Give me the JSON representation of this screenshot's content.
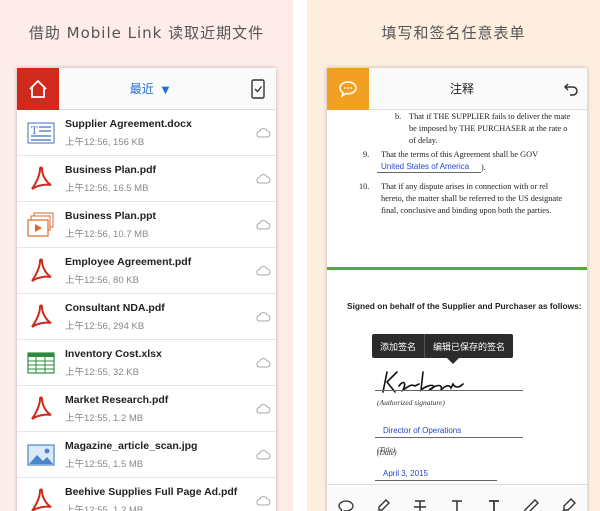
{
  "left": {
    "caption": "借助 Mobile Link 读取近期文件",
    "header": {
      "recent_label": "最近",
      "chevron": "⌄"
    },
    "files": [
      {
        "name": "Supplier Agreement.docx",
        "meta": "上午12:56, 156 KB",
        "icon": "word-doc-icon"
      },
      {
        "name": "Business Plan.pdf",
        "meta": "上午12:56, 16.5 MB",
        "icon": "pdf-icon"
      },
      {
        "name": "Business Plan.ppt",
        "meta": "上午12:56, 10.7 MB",
        "icon": "ppt-icon"
      },
      {
        "name": "Employee Agreement.pdf",
        "meta": "上午12:56, 80 KB",
        "icon": "pdf-icon"
      },
      {
        "name": "Consultant NDA.pdf",
        "meta": "上午12:56, 294 KB",
        "icon": "pdf-icon"
      },
      {
        "name": "Inventory Cost.xlsx",
        "meta": "上午12:55, 32 KB",
        "icon": "spreadsheet-icon"
      },
      {
        "name": "Market Research.pdf",
        "meta": "上午12:55, 1.2 MB",
        "icon": "pdf-icon"
      },
      {
        "name": "Magazine_article_scan.jpg",
        "meta": "上午12:55, 1.5 MB",
        "icon": "image-icon"
      },
      {
        "name": "Beehive Supplies Full Page Ad.pdf",
        "meta": "上午12:55, 1.2 MB",
        "icon": "pdf-icon"
      }
    ]
  },
  "right": {
    "caption": "填写和签名任意表单",
    "header": {
      "title": "注释"
    },
    "doc": {
      "b_marker": "b.",
      "b_line1": "That if THE SUPPLIER fails to deliver the mate",
      "b_line2": "be imposed by THE PURCHASER at the rate o",
      "b_line3": "of delay.",
      "n9": "9.",
      "line9": "That  the  terms  of  this  Agreement  shall  be  GOV",
      "line9_field": "United States of America",
      "line9_end": ").",
      "n10": "10.",
      "line10a": "That if any dispute arises in connection with or rel",
      "line10b": "hereto, the matter shall be referred to the US designate",
      "line10c": "final, conclusive and binding upon both the parties.",
      "signed_heading": "Signed on behalf of the Supplier and Purchaser as follows:",
      "authorized_label": "(Authorized signature)",
      "title_value": "Director of Operations",
      "title_label": "(Title)",
      "date_value": "April 3, 2015",
      "date_label": "(Date)"
    },
    "popup": {
      "add_signature": "添加签名",
      "edit_saved": "编辑已保存的签名"
    },
    "tools": [
      "comment-tool",
      "highlighter-tool",
      "strikethrough-tool",
      "underline-tool",
      "text-tool",
      "pen-tool",
      "sign-tool"
    ]
  },
  "colors": {
    "adobe_red": "#d02a1c",
    "comment_orange": "#f2a023",
    "link_blue": "#1f6fd1",
    "rule_green": "#55a83a"
  }
}
